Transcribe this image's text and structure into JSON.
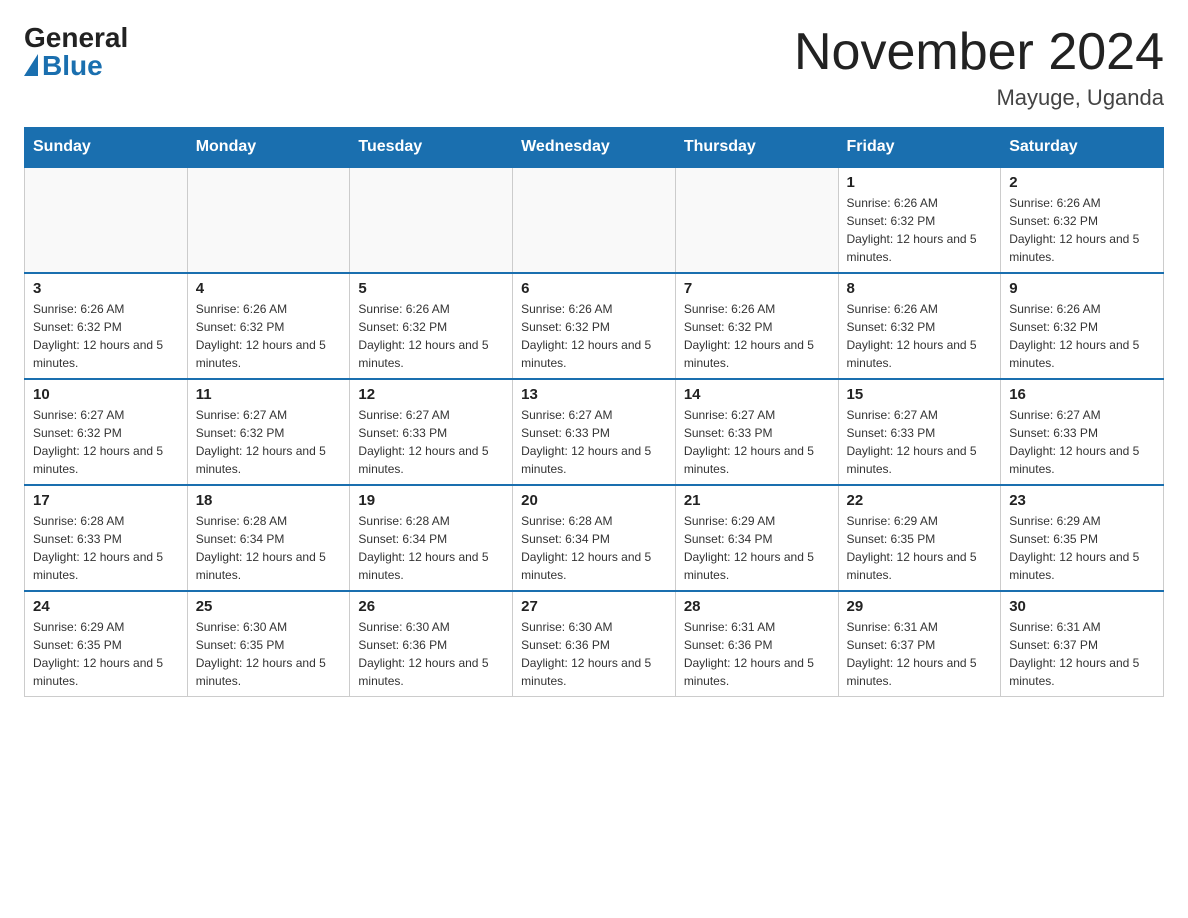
{
  "logo": {
    "general": "General",
    "blue": "Blue"
  },
  "title": "November 2024",
  "subtitle": "Mayuge, Uganda",
  "weekdays": [
    "Sunday",
    "Monday",
    "Tuesday",
    "Wednesday",
    "Thursday",
    "Friday",
    "Saturday"
  ],
  "weeks": [
    [
      {
        "day": "",
        "info": ""
      },
      {
        "day": "",
        "info": ""
      },
      {
        "day": "",
        "info": ""
      },
      {
        "day": "",
        "info": ""
      },
      {
        "day": "",
        "info": ""
      },
      {
        "day": "1",
        "info": "Sunrise: 6:26 AM\nSunset: 6:32 PM\nDaylight: 12 hours and 5 minutes."
      },
      {
        "day": "2",
        "info": "Sunrise: 6:26 AM\nSunset: 6:32 PM\nDaylight: 12 hours and 5 minutes."
      }
    ],
    [
      {
        "day": "3",
        "info": "Sunrise: 6:26 AM\nSunset: 6:32 PM\nDaylight: 12 hours and 5 minutes."
      },
      {
        "day": "4",
        "info": "Sunrise: 6:26 AM\nSunset: 6:32 PM\nDaylight: 12 hours and 5 minutes."
      },
      {
        "day": "5",
        "info": "Sunrise: 6:26 AM\nSunset: 6:32 PM\nDaylight: 12 hours and 5 minutes."
      },
      {
        "day": "6",
        "info": "Sunrise: 6:26 AM\nSunset: 6:32 PM\nDaylight: 12 hours and 5 minutes."
      },
      {
        "day": "7",
        "info": "Sunrise: 6:26 AM\nSunset: 6:32 PM\nDaylight: 12 hours and 5 minutes."
      },
      {
        "day": "8",
        "info": "Sunrise: 6:26 AM\nSunset: 6:32 PM\nDaylight: 12 hours and 5 minutes."
      },
      {
        "day": "9",
        "info": "Sunrise: 6:26 AM\nSunset: 6:32 PM\nDaylight: 12 hours and 5 minutes."
      }
    ],
    [
      {
        "day": "10",
        "info": "Sunrise: 6:27 AM\nSunset: 6:32 PM\nDaylight: 12 hours and 5 minutes."
      },
      {
        "day": "11",
        "info": "Sunrise: 6:27 AM\nSunset: 6:32 PM\nDaylight: 12 hours and 5 minutes."
      },
      {
        "day": "12",
        "info": "Sunrise: 6:27 AM\nSunset: 6:33 PM\nDaylight: 12 hours and 5 minutes."
      },
      {
        "day": "13",
        "info": "Sunrise: 6:27 AM\nSunset: 6:33 PM\nDaylight: 12 hours and 5 minutes."
      },
      {
        "day": "14",
        "info": "Sunrise: 6:27 AM\nSunset: 6:33 PM\nDaylight: 12 hours and 5 minutes."
      },
      {
        "day": "15",
        "info": "Sunrise: 6:27 AM\nSunset: 6:33 PM\nDaylight: 12 hours and 5 minutes."
      },
      {
        "day": "16",
        "info": "Sunrise: 6:27 AM\nSunset: 6:33 PM\nDaylight: 12 hours and 5 minutes."
      }
    ],
    [
      {
        "day": "17",
        "info": "Sunrise: 6:28 AM\nSunset: 6:33 PM\nDaylight: 12 hours and 5 minutes."
      },
      {
        "day": "18",
        "info": "Sunrise: 6:28 AM\nSunset: 6:34 PM\nDaylight: 12 hours and 5 minutes."
      },
      {
        "day": "19",
        "info": "Sunrise: 6:28 AM\nSunset: 6:34 PM\nDaylight: 12 hours and 5 minutes."
      },
      {
        "day": "20",
        "info": "Sunrise: 6:28 AM\nSunset: 6:34 PM\nDaylight: 12 hours and 5 minutes."
      },
      {
        "day": "21",
        "info": "Sunrise: 6:29 AM\nSunset: 6:34 PM\nDaylight: 12 hours and 5 minutes."
      },
      {
        "day": "22",
        "info": "Sunrise: 6:29 AM\nSunset: 6:35 PM\nDaylight: 12 hours and 5 minutes."
      },
      {
        "day": "23",
        "info": "Sunrise: 6:29 AM\nSunset: 6:35 PM\nDaylight: 12 hours and 5 minutes."
      }
    ],
    [
      {
        "day": "24",
        "info": "Sunrise: 6:29 AM\nSunset: 6:35 PM\nDaylight: 12 hours and 5 minutes."
      },
      {
        "day": "25",
        "info": "Sunrise: 6:30 AM\nSunset: 6:35 PM\nDaylight: 12 hours and 5 minutes."
      },
      {
        "day": "26",
        "info": "Sunrise: 6:30 AM\nSunset: 6:36 PM\nDaylight: 12 hours and 5 minutes."
      },
      {
        "day": "27",
        "info": "Sunrise: 6:30 AM\nSunset: 6:36 PM\nDaylight: 12 hours and 5 minutes."
      },
      {
        "day": "28",
        "info": "Sunrise: 6:31 AM\nSunset: 6:36 PM\nDaylight: 12 hours and 5 minutes."
      },
      {
        "day": "29",
        "info": "Sunrise: 6:31 AM\nSunset: 6:37 PM\nDaylight: 12 hours and 5 minutes."
      },
      {
        "day": "30",
        "info": "Sunrise: 6:31 AM\nSunset: 6:37 PM\nDaylight: 12 hours and 5 minutes."
      }
    ]
  ]
}
